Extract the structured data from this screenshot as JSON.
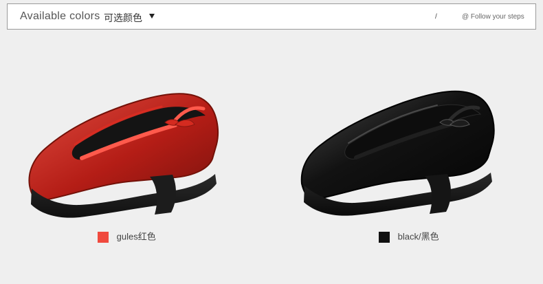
{
  "header": {
    "title_en": "Available colors",
    "title_cn": "可选颜色",
    "dropdown_icon": "triangle-down-icon",
    "separator": "/",
    "follow_text": "@ Follow your steps"
  },
  "colors": {
    "items": [
      {
        "label": "gules红色",
        "swatch": "#f04a3e",
        "shoe_body": "#b41d16",
        "shoe_highlight": "#e0493e"
      },
      {
        "label": "black/黑色",
        "swatch": "#111111",
        "shoe_body": "#111111",
        "shoe_highlight": "#3a3a3a"
      }
    ]
  }
}
